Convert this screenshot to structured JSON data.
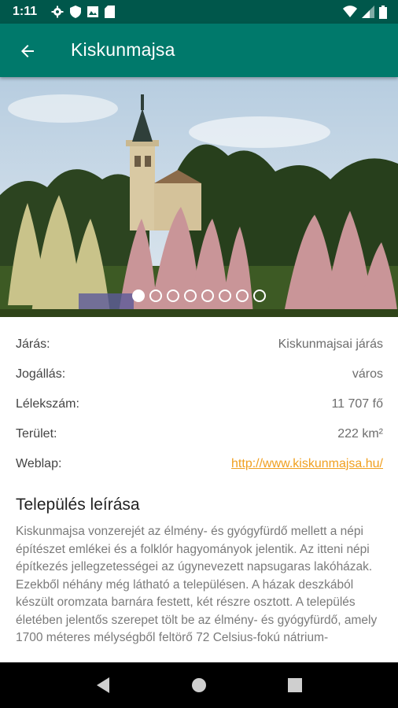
{
  "status_bar": {
    "time": "1:11",
    "left_icons": [
      "settings-icon",
      "shield-icon",
      "photo-icon",
      "sd-card-icon"
    ],
    "right_icons": [
      "wifi-icon",
      "cell-signal-icon",
      "battery-icon"
    ]
  },
  "app_bar": {
    "title": "Kiskunmajsa",
    "back_icon": "arrow-back-icon"
  },
  "carousel": {
    "image_description_icon": "church-photo",
    "dots_count": 8,
    "active_index": 0
  },
  "info": {
    "jaras": {
      "label": "Járás:",
      "value": "Kiskunmajsai járás"
    },
    "jogallas": {
      "label": "Jogállás:",
      "value": "város"
    },
    "lelekszam": {
      "label": "Lélekszám:",
      "value": "11 707 fő"
    },
    "terulet": {
      "label": "Terület:",
      "value": "222 km²"
    },
    "weblap": {
      "label": "Weblap:",
      "value": "http://www.kiskunmajsa.hu/"
    }
  },
  "description": {
    "title": "Település leírása",
    "text": "Kiskunmajsa vonzerejét az élmény- és gyógyfürdő mellett a népi építészet emlékei és a folklór hagyományok jelentik. Az itteni népi építkezés jellegzetességei az úgynevezett napsugaras lakóházak. Ezekből néhány még látható a településen. A házak deszkából készült oromzata barnára festett, két részre osztott. A település életében jelentős szerepet tölt be az élmény- és gyógyfürdő, amely 1700 méteres mélységből feltörő 72 Celsius-fokú nátrium-"
  },
  "nav_bar": {
    "icons": [
      "nav-back-icon",
      "nav-home-icon",
      "nav-recents-icon"
    ]
  },
  "colors": {
    "status_bar": "#00574b",
    "app_bar": "#00796b",
    "link": "#f0a020"
  }
}
